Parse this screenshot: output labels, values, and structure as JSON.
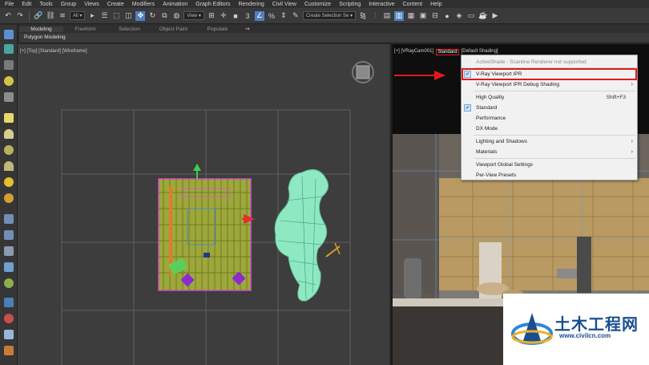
{
  "menubar": [
    "File",
    "Edit",
    "Tools",
    "Group",
    "Views",
    "Create",
    "Modifiers",
    "Animation",
    "Graph Editors",
    "Rendering",
    "Civil View",
    "Customize",
    "Scripting",
    "Interactive",
    "Content",
    "Help"
  ],
  "toolbar": {
    "filter_value": "All",
    "view_value": "View",
    "selection_set_value": "Create Selection Se"
  },
  "ribbon": {
    "tabs": [
      "Modeling",
      "Freeform",
      "Selection",
      "Object Paint",
      "Populate"
    ],
    "active_tab": "Modeling",
    "subtitle": "Polygon Modeling"
  },
  "left_viewport": {
    "label": "[+] [Top] [Standard] [Wireframe]"
  },
  "right_viewport": {
    "label_prefix": "[+] [VRayCam001]",
    "label_highlight": "Standard",
    "label_suffix": "[Default Shading]"
  },
  "dropdown": {
    "items": [
      {
        "label": "ActiveShade - Scanline Renderer not supported",
        "disabled": true
      },
      {
        "label": "V-Ray Viewport IPR",
        "checked": true
      },
      {
        "label": "V-Ray Viewport IPR Debug Shading",
        "submenu": true
      },
      {
        "label": "High Quality",
        "shortcut": "Shift+F3"
      },
      {
        "label": "Standard",
        "checked": true
      },
      {
        "label": "Performance"
      },
      {
        "label": "DX Mode"
      },
      {
        "label": "Lighting and Shadows",
        "submenu": true
      },
      {
        "label": "Materials",
        "submenu": true
      },
      {
        "label": "Viewport Global Settings"
      },
      {
        "label": "Per-View Presets"
      }
    ]
  },
  "watermark": {
    "name": "土木工程网",
    "url": "www.civilcn.com"
  },
  "colors": {
    "highlight_red": "#e01a1a",
    "wire_green": "#8ee8c2",
    "accent_blue": "#4f7fbf"
  }
}
